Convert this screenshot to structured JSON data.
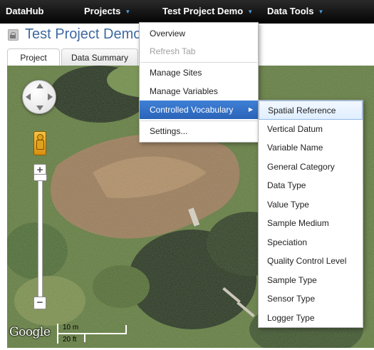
{
  "nav": {
    "brand": "DataHub",
    "projects": "Projects",
    "current_project": "Test Project Demo",
    "data_tools": "Data Tools"
  },
  "page": {
    "title": "Test Project Demo"
  },
  "tabs": [
    {
      "label": "Project"
    },
    {
      "label": "Data Summary"
    }
  ],
  "map": {
    "logo": "Google",
    "scale_top": "10 m",
    "scale_bottom": "20 ft",
    "zoom_in": "+",
    "zoom_out": "−"
  },
  "dropdown": {
    "items": [
      {
        "label": "Overview"
      },
      {
        "label": "Refresh Tab"
      },
      {
        "label": "Manage Sites"
      },
      {
        "label": "Manage Variables"
      },
      {
        "label": "Controlled Vocabulary"
      },
      {
        "label": "Settings..."
      }
    ],
    "submenu_arrow": "▶"
  },
  "submenu": {
    "items": [
      {
        "label": "Spatial Reference"
      },
      {
        "label": "Vertical Datum"
      },
      {
        "label": "Variable Name"
      },
      {
        "label": "General Category"
      },
      {
        "label": "Data Type"
      },
      {
        "label": "Value Type"
      },
      {
        "label": "Sample Medium"
      },
      {
        "label": "Speciation"
      },
      {
        "label": "Quality Control Level"
      },
      {
        "label": "Sample Type"
      },
      {
        "label": "Sensor Type"
      },
      {
        "label": "Logger Type"
      }
    ]
  },
  "icons": {
    "nav_caret": "▼",
    "lock": "lock-icon",
    "pegman": "pegman-icon",
    "pan": "pan-control-icon"
  },
  "colors": {
    "nav_bg": "#0a0a0a",
    "accent": "#4a9ad8",
    "title": "#3e6aa0",
    "menu_highlight": "#3471c7",
    "submenu_highlight": "#e6f0fd"
  }
}
